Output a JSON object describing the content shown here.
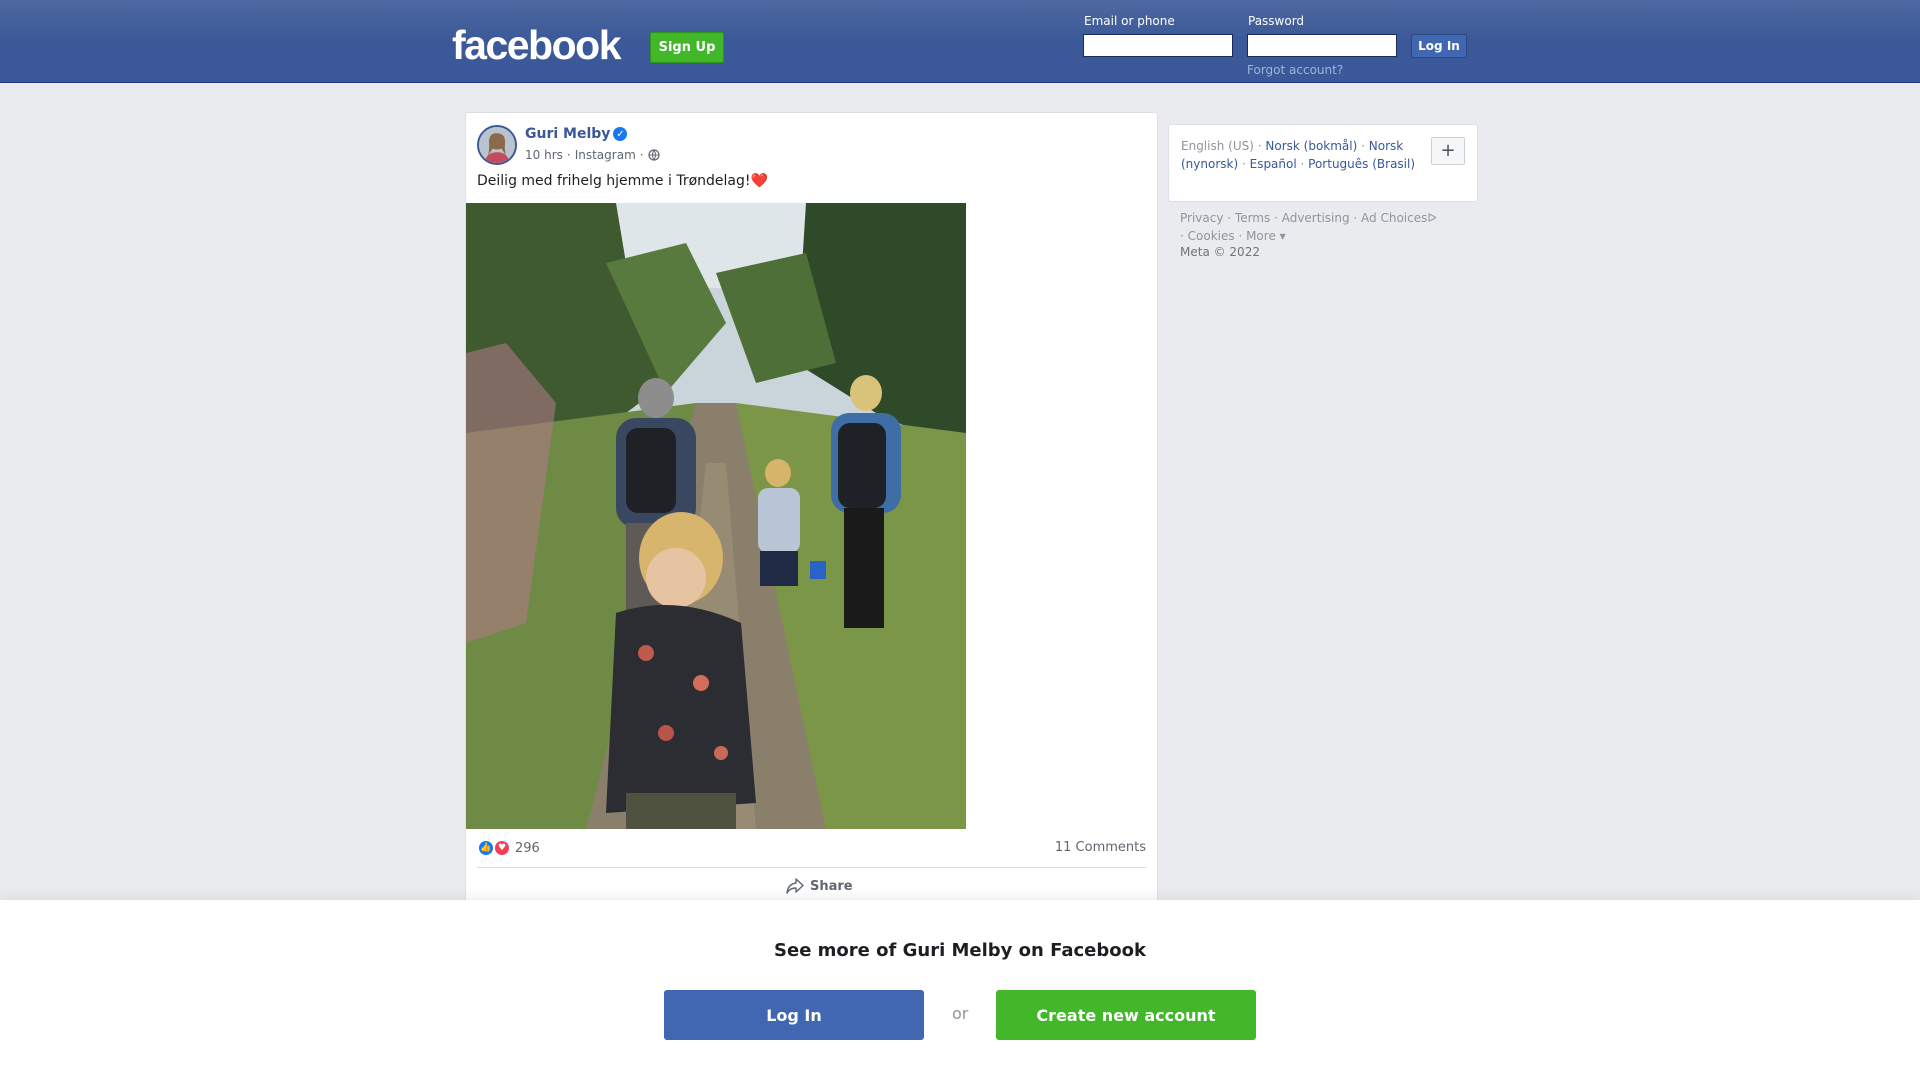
{
  "header": {
    "logo": "facebook",
    "signup_label": "Sign Up",
    "email_label": "Email or phone",
    "password_label": "Password",
    "login_label": "Log In",
    "forgot_label": "Forgot account?"
  },
  "post": {
    "author": "Guri Melby",
    "time": "10 hrs",
    "source": "Instagram",
    "text": "Deilig med frihelg hjemme i Trøndelag!❤️",
    "reaction_count": "296",
    "comments": "11 Comments",
    "share_label": "Share",
    "icons": [
      "globe-icon",
      "verified-badge-icon",
      "like-reaction-icon",
      "love-reaction-icon",
      "share-icon"
    ]
  },
  "sidebar": {
    "languages": {
      "current": "English (US)",
      "options": [
        "Norsk (bokmål)",
        "Norsk (nynorsk)",
        "Español",
        "Português (Brasil)"
      ]
    },
    "add_language": "+",
    "footer_links": [
      "Privacy",
      "Terms",
      "Advertising",
      "Ad Choices",
      "Cookies",
      "More"
    ],
    "copyright": "Meta © 2022"
  },
  "overlay": {
    "heading": "See more of Guri Melby on Facebook",
    "login_label": "Log In",
    "or_label": "or",
    "create_label": "Create new account"
  },
  "colors": {
    "brand_blue": "#4267b2",
    "header_blue": "#3b5998",
    "green": "#42b72a",
    "background": "#e9ebee"
  }
}
